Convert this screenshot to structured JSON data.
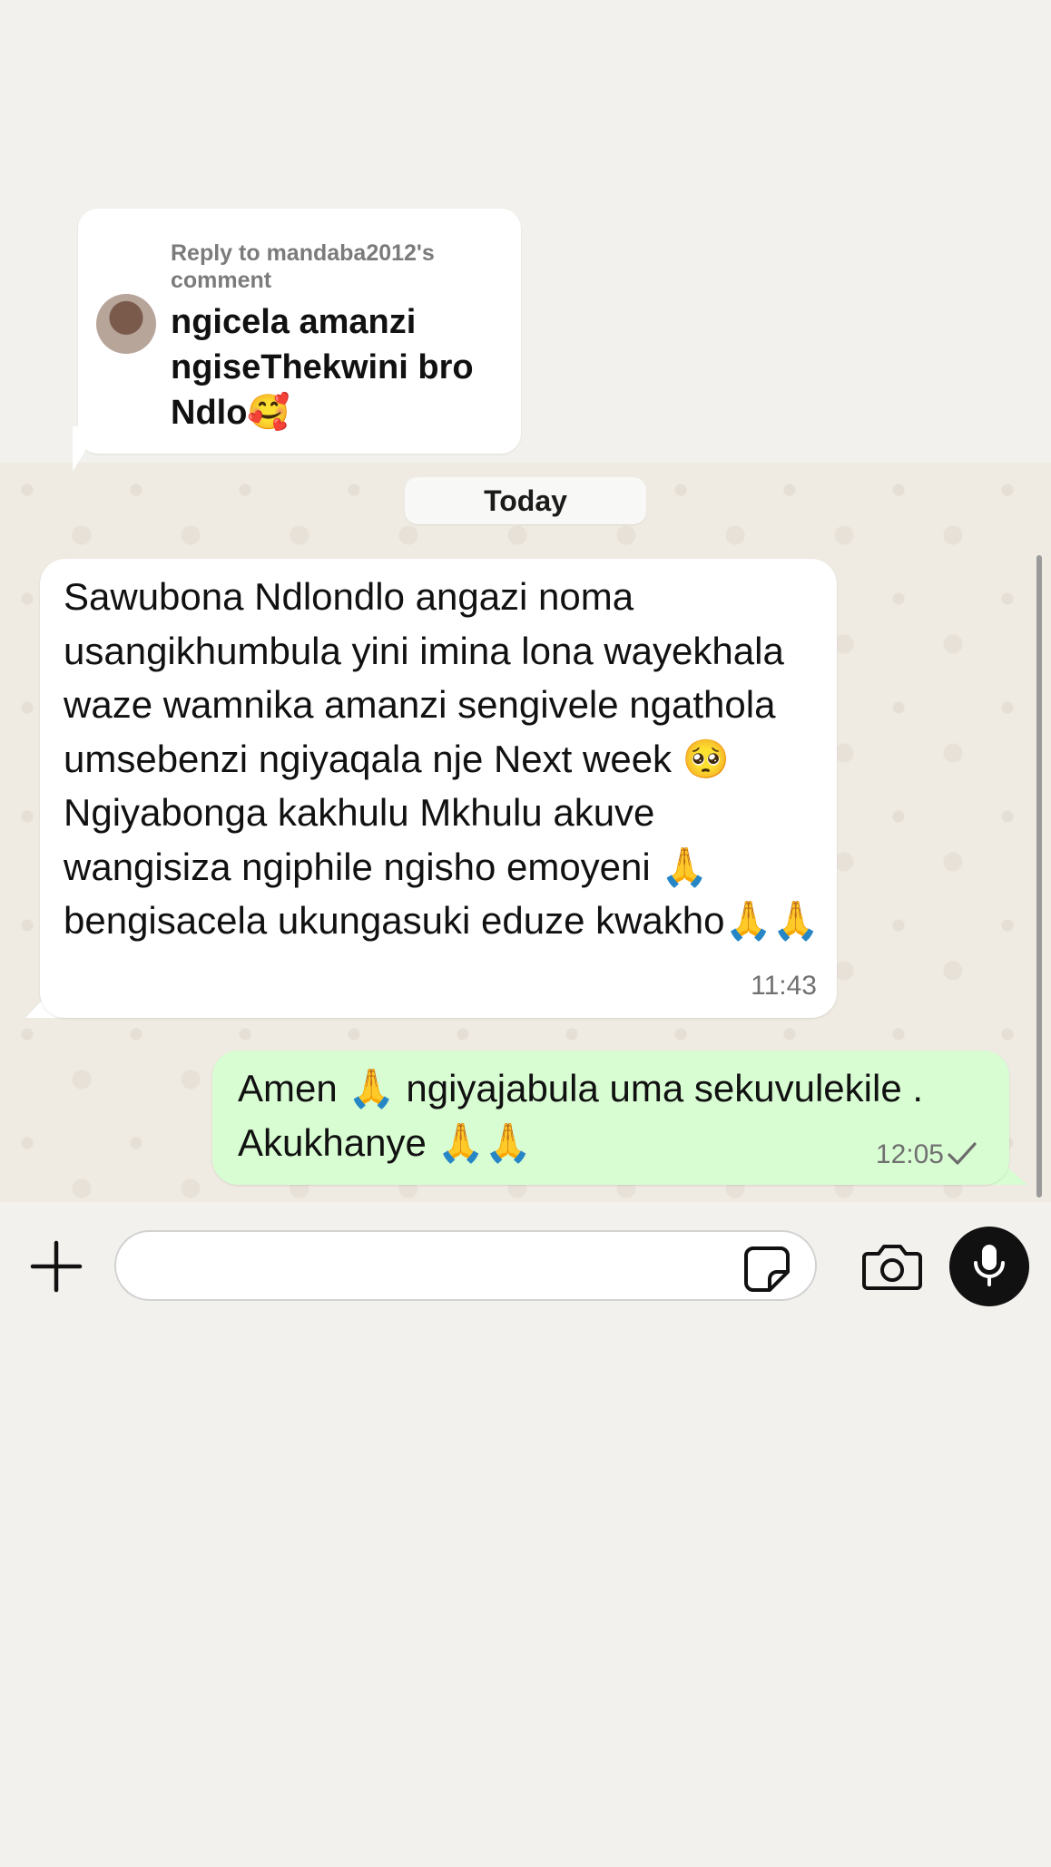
{
  "reply": {
    "meta": "Reply to mandaba2012's comment",
    "text": "ngicela amanzi ngiseThekwini bro Ndlo🥰"
  },
  "date_separator": "Today",
  "messages": [
    {
      "direction": "incoming",
      "text": "Sawubona Ndlondlo angazi noma usangikhumbula yini imina lona wayekhala waze wamnika amanzi sengivele ngathola umsebenzi ngiyaqala nje Next week 🥺 Ngiyabonga kakhulu Mkhulu akuve wangisiza ngiphile ngisho emoyeni 🙏bengisacela ukungasuki eduze kwakho🙏🙏",
      "time": "11:43"
    },
    {
      "direction": "outgoing",
      "text": "Amen 🙏 ngiyajabula uma sekuvulekile . Akukhanye 🙏🙏",
      "time": "12:05",
      "status": "sent-check-icon"
    }
  ],
  "composer": {
    "placeholder": "",
    "plus_icon": "plus-icon",
    "sticker_icon": "sticker-icon",
    "camera_icon": "camera-icon",
    "mic_icon": "microphone-icon"
  },
  "colors": {
    "incoming_bubble": "#ffffff",
    "outgoing_bubble": "#d9fdd3",
    "background": "#efeae2",
    "mic_button": "#111111"
  }
}
